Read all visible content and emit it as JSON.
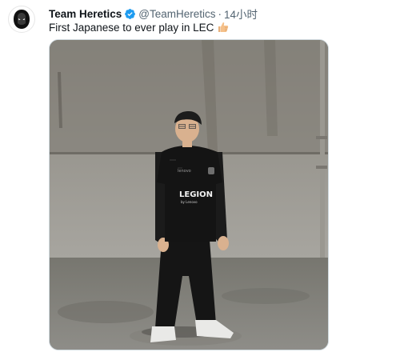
{
  "tweet": {
    "author_name": "Team Heretics",
    "handle": "@TeamHeretics",
    "separator": "·",
    "time": "14小时",
    "text": "First Japanese to ever play in LEC",
    "emoji_icon": "thumbs-up-emoji",
    "verified_icon": "verified-badge-icon",
    "jersey_text": "LEGION",
    "jersey_subtext": "by Lenovo"
  },
  "colors": {
    "verified": "#1d9bf0",
    "secondary_text": "#536471",
    "primary_text": "#0f1419"
  }
}
